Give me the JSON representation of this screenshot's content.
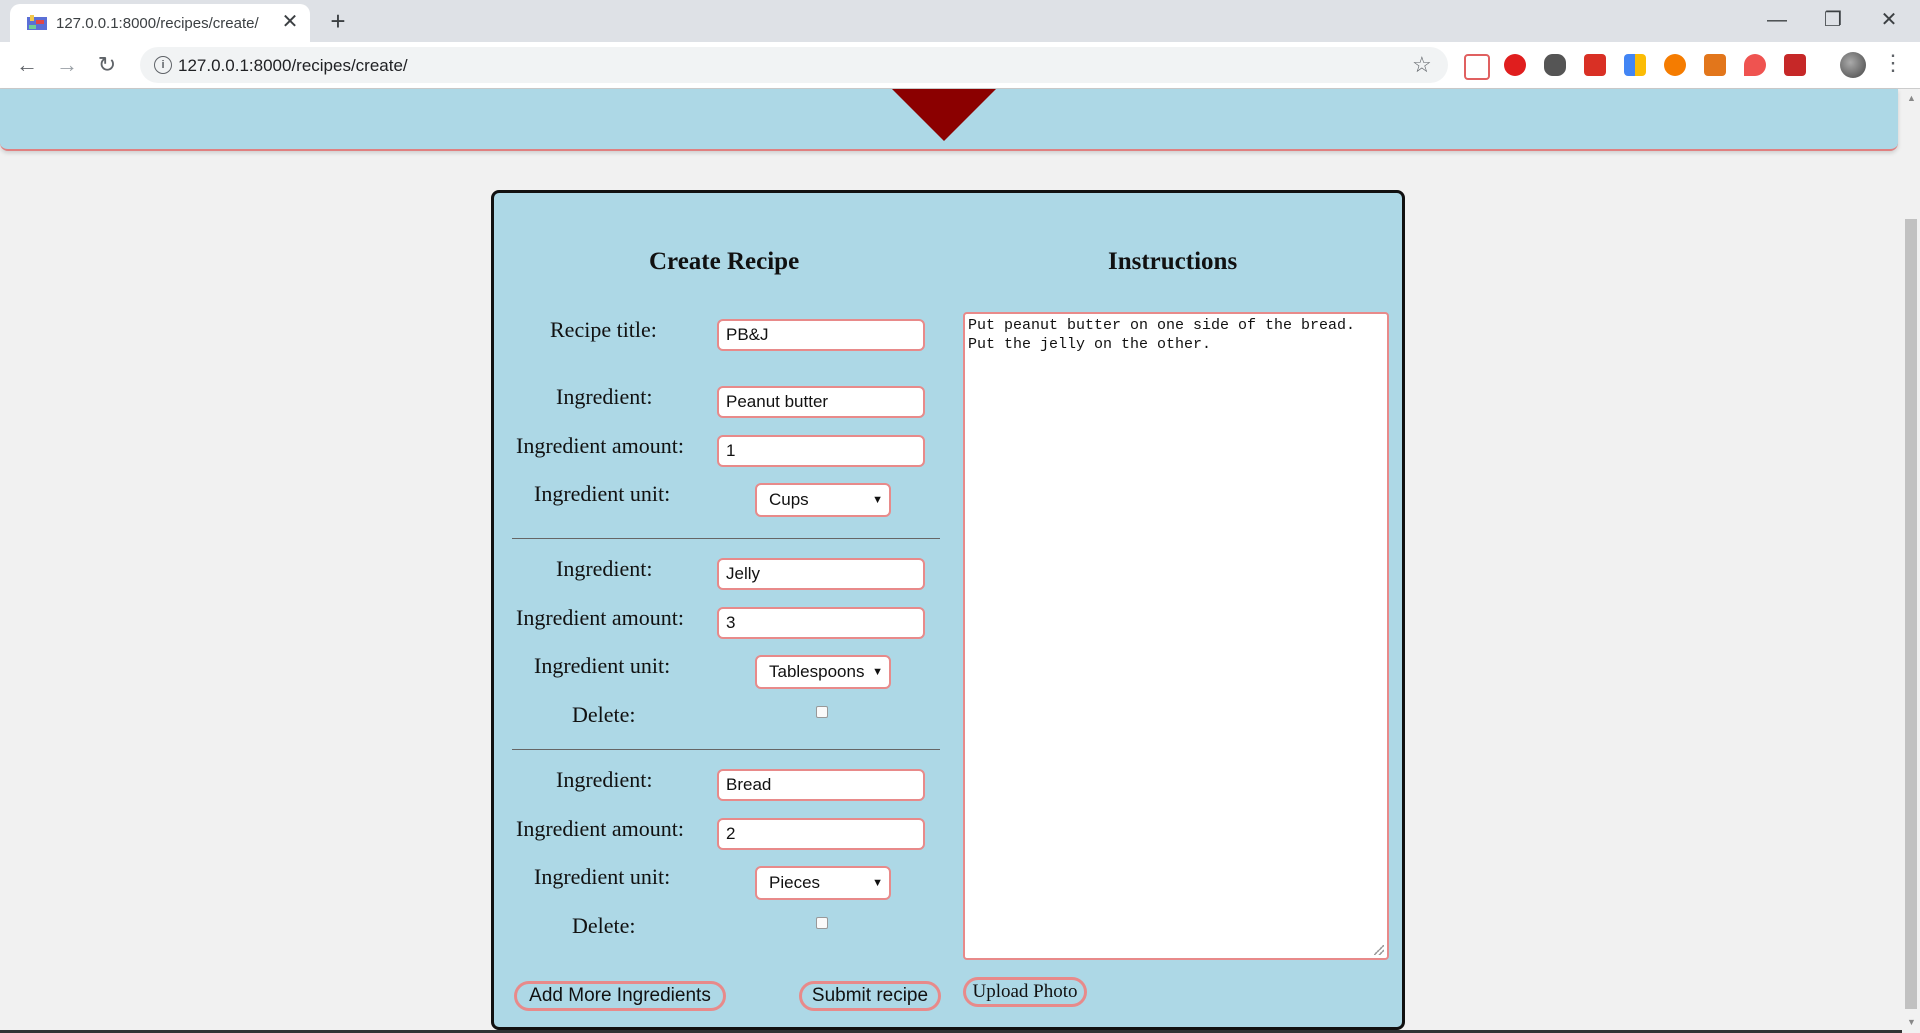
{
  "browser": {
    "tab_title": "127.0.0.1:8000/recipes/create/",
    "tab_close": "✕",
    "new_tab": "+",
    "url": "127.0.0.1:8000/recipes/create/",
    "window": {
      "minimize": "—",
      "restore": "❐",
      "close": "✕"
    },
    "nav": {
      "back": "←",
      "forward": "→",
      "reload": "↻"
    }
  },
  "form": {
    "title": "Create Recipe",
    "recipe_title_label": "Recipe title:",
    "recipe_title_value": "PB&J",
    "ingredients": [
      {
        "ingredient_label": "Ingredient:",
        "ingredient_value": "Peanut butter",
        "amount_label": "Ingredient amount:",
        "amount_value": "1",
        "unit_label": "Ingredient unit:",
        "unit_value": "Cups"
      },
      {
        "ingredient_label": "Ingredient:",
        "ingredient_value": "Jelly",
        "amount_label": "Ingredient amount:",
        "amount_value": "3",
        "unit_label": "Ingredient unit:",
        "unit_value": "Tablespoons",
        "delete_label": "Delete:"
      },
      {
        "ingredient_label": "Ingredient:",
        "ingredient_value": "Bread",
        "amount_label": "Ingredient amount:",
        "amount_value": "2",
        "unit_label": "Ingredient unit:",
        "unit_value": "Pieces",
        "delete_label": "Delete:"
      }
    ],
    "add_more_label": "Add More Ingredients",
    "submit_label": "Submit recipe"
  },
  "instructions": {
    "title": "Instructions",
    "text": "Put peanut butter on one side of the bread.\nPut the jelly on the other.",
    "upload_label": "Upload Photo"
  },
  "colors": {
    "page_bg": "#f1f1f1",
    "card_bg": "#add8e6",
    "input_border": "#e88a8a",
    "header_triangle": "#8b0000"
  }
}
